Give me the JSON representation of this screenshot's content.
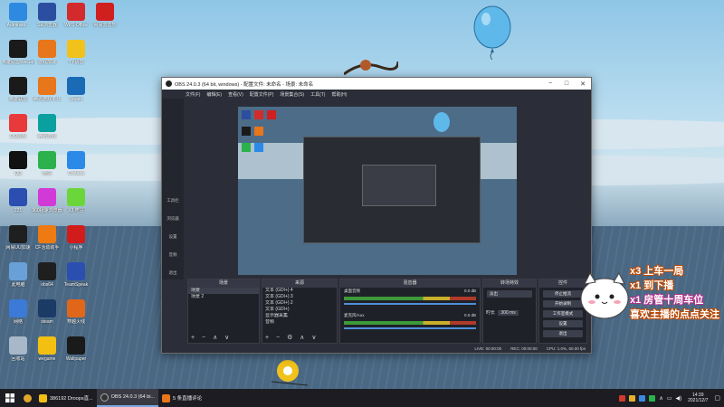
{
  "desktop_icons": [
    {
      "label": "Administr...",
      "color": "#2d8ae0"
    },
    {
      "label": "SE浏览器",
      "color": "#2b4ea0"
    },
    {
      "label": "WPS Office",
      "color": "#d32b2b"
    },
    {
      "label": "网易云音乐",
      "color": "#d01f1f"
    },
    {
      "label": "英雄联盟WeGame",
      "color": "#1a1a1a"
    },
    {
      "label": "游戏加速",
      "color": "#e8761a"
    },
    {
      "label": "YY语音",
      "color": "#f1c21b"
    },
    {
      "label": "英雄联盟",
      "color": "#1a1a1a"
    },
    {
      "label": "腾讯游戏平台",
      "color": "#e8761a"
    },
    {
      "label": "Steam",
      "color": "#1b6ab5"
    },
    {
      "label": "QQ游戏",
      "color": "#e83a3a"
    },
    {
      "label": "腾讯游戏",
      "color": "#0aa0a0"
    },
    {
      "label": "QQ",
      "color": "#111111"
    },
    {
      "label": "微信",
      "color": "#2bb24c"
    },
    {
      "label": "Cortana",
      "color": "#2b8ae8"
    },
    {
      "label": "221",
      "color": "#2a4fb0"
    },
    {
      "label": "360极速浏览器",
      "color": "#d23ad8"
    },
    {
      "label": "X3 吃豆",
      "color": "#6ad63a"
    },
    {
      "label": "网易UU加速",
      "color": "#1f1f1f"
    },
    {
      "label": "CF活动助手",
      "color": "#ee7a12"
    },
    {
      "label": "小程序",
      "color": "#d21c1c"
    },
    {
      "label": "此电脑",
      "color": "#6aa0d8"
    },
    {
      "label": "obs64",
      "color": "#1f1f1f"
    },
    {
      "label": "TeamSpeak",
      "color": "#2a4fb0"
    },
    {
      "label": "网络",
      "color": "#3c7ad8"
    },
    {
      "label": "steam",
      "color": "#1b3a66"
    },
    {
      "label": "穿越火线",
      "color": "#e0661a"
    },
    {
      "label": "回收站",
      "color": "#a8b8c8"
    },
    {
      "label": "wegame",
      "color": "#f3c011"
    },
    {
      "label": "Wallpaper",
      "color": "#1a1a1a"
    }
  ],
  "obs": {
    "title": "OBS 24.0.3 (64 bit, windows) - 配置文件: 未命名 - 场景: 未命名",
    "menu": [
      "文件(F)",
      "编辑(E)",
      "查看(V)",
      "配置文件(P)",
      "场景集合(S)",
      "工具(T)",
      "帮助(H)"
    ],
    "side_buttons": [
      "工具栏",
      "浏览器",
      "设置",
      "音频",
      "退出"
    ],
    "docks": {
      "scenes": {
        "title": "场景",
        "items": [
          "场景",
          "场景 2"
        ]
      },
      "sources": {
        "title": "来源",
        "items": [
          "文本 (GDI+) 4",
          "文本 (GDI+) 3",
          "文本 (GDI+) 2",
          "文本 (GDI+)",
          "显示器采集",
          "音频"
        ]
      },
      "mixer": {
        "title": "混音器",
        "channels": [
          {
            "name": "桌面音频",
            "db": "0.0 dB"
          },
          {
            "name": "麦克风/Aux",
            "db": "0.0 dB"
          }
        ]
      },
      "transitions": {
        "title": "转场特效",
        "type": "淡出",
        "duration_label": "时长",
        "duration": "300 ms"
      },
      "controls": {
        "title": "控件",
        "buttons": [
          "停止推流",
          "开始录制",
          "工作室模式",
          "设置",
          "退出"
        ]
      }
    },
    "status": {
      "live": "LIVE: 00:00:00",
      "rec": "REC: 00:00:00",
      "cpu": "CPU: 1.0%, 60.00 fps"
    }
  },
  "overlay": {
    "lines": [
      "x3 上车一局",
      "x1 到下播",
      "x1 房管十周车位",
      "喜欢主播的点点关注"
    ]
  },
  "taskbar": {
    "apps": [
      {
        "label": "386192 Droops直...",
        "color": "#f3c011",
        "active": false
      },
      {
        "label": "OBS 24.0.3 (64 bi...",
        "color": "#333333",
        "active": true
      },
      {
        "label": "5 条直播评论",
        "color": "#e8761a",
        "active": false
      }
    ],
    "time": "14:39",
    "date": "2021/12/7"
  }
}
